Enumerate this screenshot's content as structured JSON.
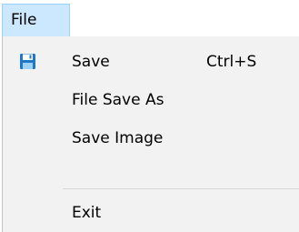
{
  "menubar": {
    "file_label": "File"
  },
  "menu": {
    "items": [
      {
        "label": "Save",
        "shortcut": "Ctrl+S",
        "icon": "floppy-disk-icon"
      },
      {
        "label": "File Save As"
      },
      {
        "label": "Save Image"
      },
      {
        "label": "Exit"
      }
    ]
  },
  "colors": {
    "menubar_highlight": "#cce8ff",
    "menubar_highlight_border": "#99d1ff",
    "dropdown_background": "#f2f2f2",
    "icon_blue": "#1e78c8"
  }
}
